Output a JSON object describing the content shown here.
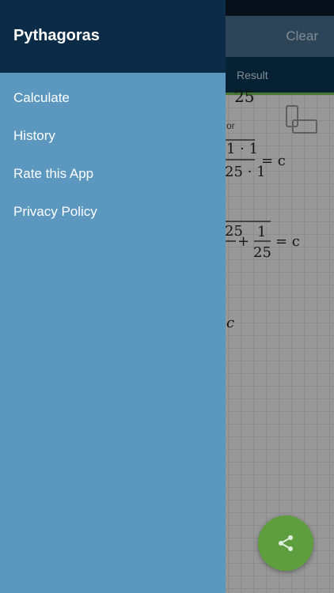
{
  "drawer": {
    "title": "Pythagoras",
    "items": [
      {
        "label": "Calculate"
      },
      {
        "label": "History"
      },
      {
        "label": "Rate this App"
      },
      {
        "label": "Privacy Policy"
      }
    ]
  },
  "toolbar": {
    "clear_label": "Clear"
  },
  "tabs": {
    "result_label": "Result"
  },
  "content": {
    "or_label": "or",
    "expr_top": "25",
    "expr_a": "1·1 / 25·1 = c",
    "expr_b": "25 + 1/25 = c",
    "expr_c": "c"
  },
  "colors": {
    "drawer_bg": "#5b97bf",
    "drawer_header": "#0b2b46",
    "tab_bar": "#0b3654",
    "tab_indicator": "#6fbf4c",
    "fab": "#5e9e3e"
  },
  "icons": {
    "share": "share-icon",
    "triangle": "triangle-icon"
  }
}
